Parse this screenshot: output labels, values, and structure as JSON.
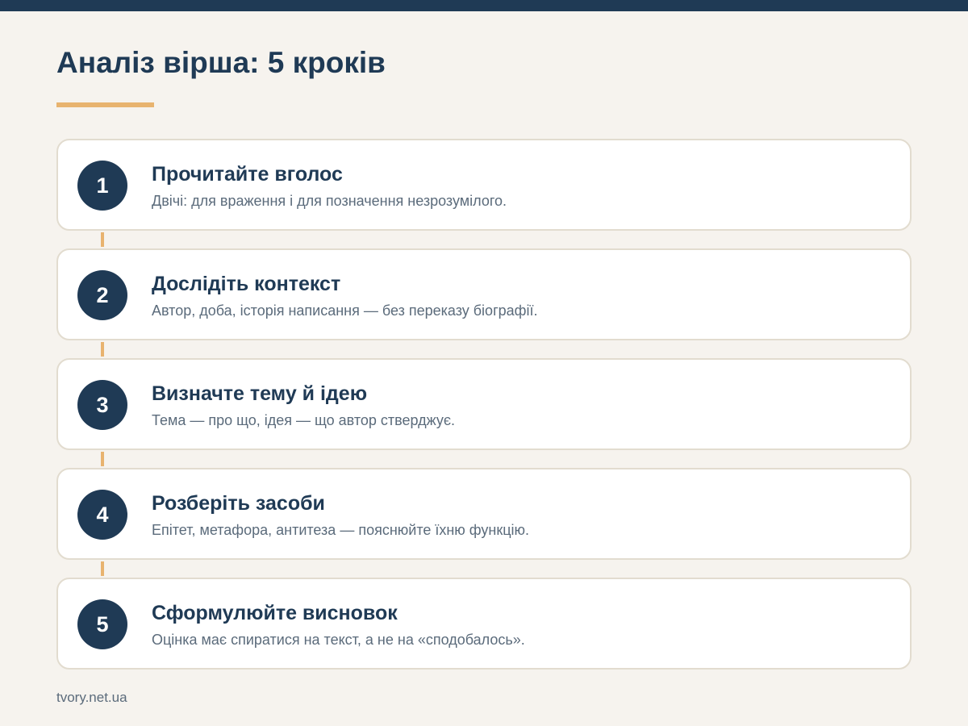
{
  "page": {
    "title": "Аналіз вірша: 5 кроків",
    "source": "tvory.net.ua"
  },
  "colors": {
    "primary": "#1f3a55",
    "accent": "#e8b36f",
    "background": "#f6f3ee",
    "card_border": "#e2dccf",
    "muted_text": "#5b6b7b"
  },
  "steps": [
    {
      "number": "1",
      "title": "Прочитайте вголос",
      "description": "Двічі: для враження і для позначення незрозумілого."
    },
    {
      "number": "2",
      "title": "Дослідіть контекст",
      "description": "Автор, доба, історія написання — без переказу біографії."
    },
    {
      "number": "3",
      "title": "Визначте тему й ідею",
      "description": "Тема — про що, ідея — що автор стверджує."
    },
    {
      "number": "4",
      "title": "Розберіть засоби",
      "description": "Епітет, метафора, антитеза — пояснюйте їхню функцію."
    },
    {
      "number": "5",
      "title": "Сформулюйте висновок",
      "description": "Оцінка має спиратися на текст, а не на «сподобалось»."
    }
  ]
}
